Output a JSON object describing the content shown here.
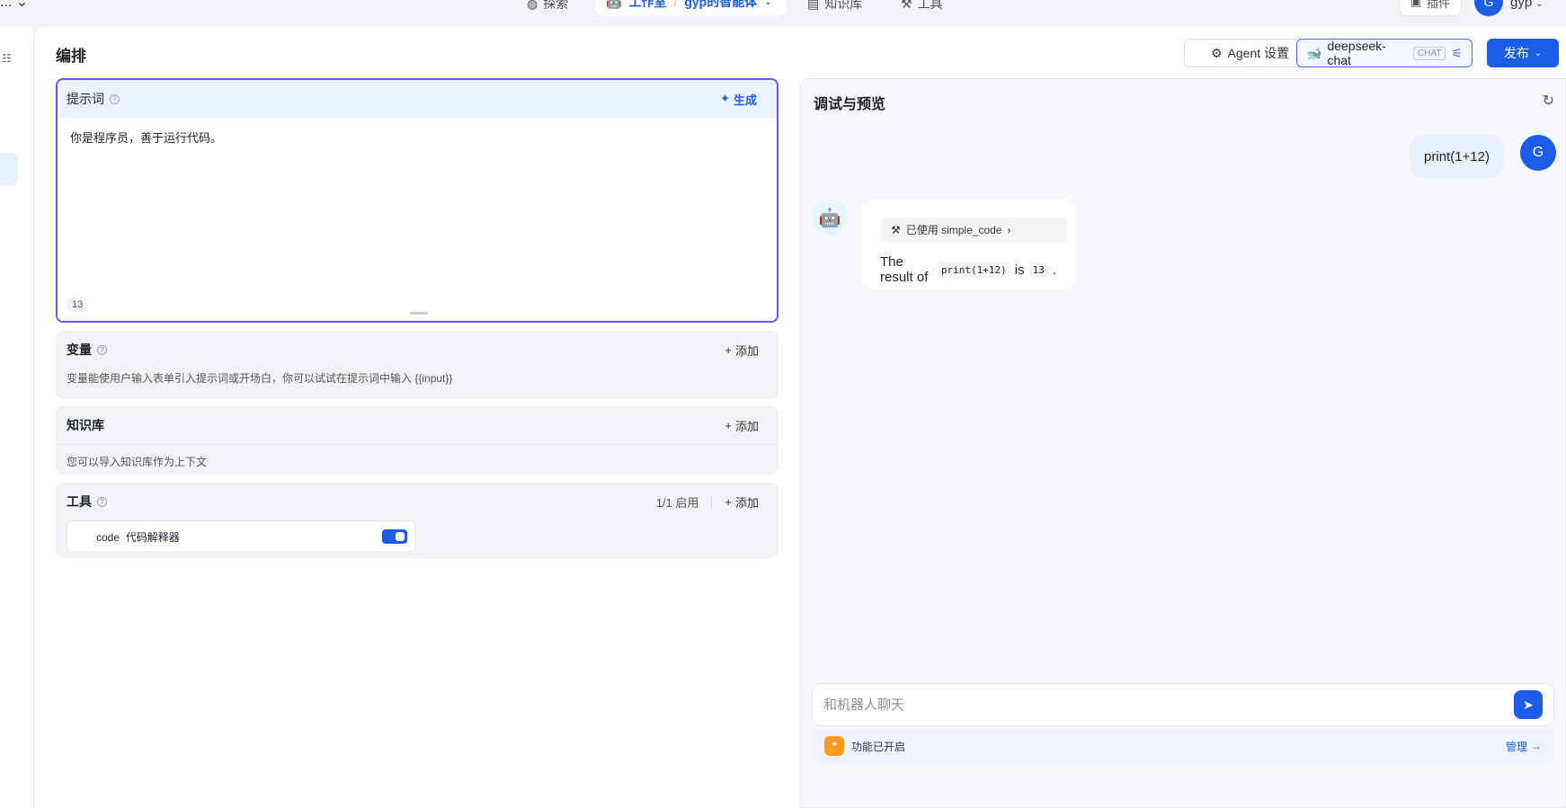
{
  "nav": {
    "left_label": "...",
    "explore": "探索",
    "workspace": "工作室",
    "agent_name": "gyp的智能体",
    "knowledge": "知识库",
    "tools": "工具",
    "plugin": "插件",
    "user_initial": "G",
    "user_name": "gyp"
  },
  "header": {
    "title": "编排",
    "agent_settings": "Agent 设置",
    "model_name": "deepseek-chat",
    "model_badge": "CHAT",
    "publish": "发布"
  },
  "prompt": {
    "title": "提示词",
    "generate": "生成",
    "text": "你是程序员，善于运行代码。",
    "char_count": "13"
  },
  "variables": {
    "title": "变量",
    "add": "添加",
    "desc": "变量能使用户输入表单引入提示词或开场白，你可以试试在提示词中输入 {{input}}"
  },
  "knowledge": {
    "title": "知识库",
    "add": "添加",
    "desc": "您可以导入知识库作为上下文"
  },
  "tools": {
    "title": "工具",
    "status": "1/1 启用",
    "add": "添加",
    "item_name": "code",
    "item_desc": "代码解释器",
    "enabled": true
  },
  "debug": {
    "title": "调试与预览",
    "user_message": "print(1+12)",
    "user_initial": "G",
    "tool_used_label": "已使用 simple_code",
    "bot_reply": {
      "prefix": "The result of",
      "code": "print(1+12)",
      "mid": "is",
      "value": "13",
      "suffix": "."
    },
    "input_placeholder": "和机器人聊天",
    "feature_status": "功能已开启",
    "manage": "管理"
  },
  "colors": {
    "accent": "#1b5de6",
    "prompt_border": "#6b55f5",
    "feature_icon": "#ff9a1f"
  }
}
